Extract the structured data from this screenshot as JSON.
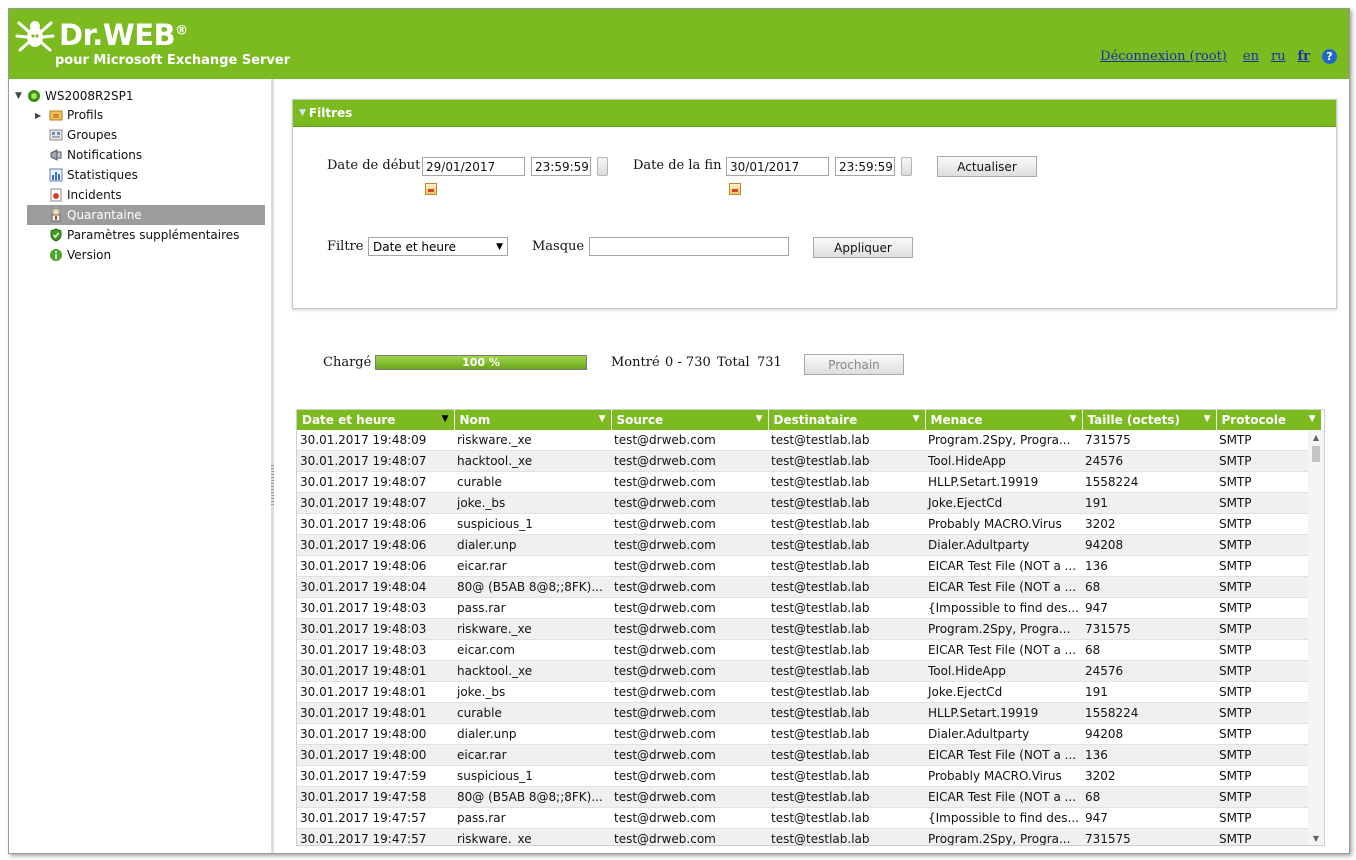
{
  "header": {
    "logo_text": "Dr.WEB",
    "logo_mark": "®",
    "subtitle": "pour Microsoft Exchange Server",
    "logout": "Déconnexion (root)",
    "lang_en": "en",
    "lang_ru": "ru",
    "lang_fr": "fr",
    "help": "?"
  },
  "sidebar": {
    "root": "WS2008R2SP1",
    "items": [
      {
        "label": "Profils",
        "icon": "folder-icon"
      },
      {
        "label": "Groupes",
        "icon": "groups-icon"
      },
      {
        "label": "Notifications",
        "icon": "megaphone-icon"
      },
      {
        "label": "Statistiques",
        "icon": "statistics-icon"
      },
      {
        "label": "Incidents",
        "icon": "incidents-icon"
      },
      {
        "label": "Quarantaine",
        "icon": "quarantine-icon"
      },
      {
        "label": "Paramètres supplémentaires",
        "icon": "shield-icon"
      },
      {
        "label": "Version",
        "icon": "info-icon"
      }
    ],
    "selected": "Quarantaine"
  },
  "filters": {
    "title": "Filtres",
    "start_label": "Date de début",
    "start_date": "29/01/2017",
    "start_time": "23:59:59",
    "end_label": "Date de la fin",
    "end_date": "30/01/2017",
    "end_time": "23:59:59",
    "refresh_button": "Actualiser",
    "filter_label": "Filtre",
    "filter_value": "Date et heure",
    "mask_label": "Masque",
    "mask_value": "",
    "apply_button": "Appliquer"
  },
  "status": {
    "loaded_label": "Chargé",
    "progress_text": "100 %",
    "progress_fraction": 1.0,
    "shown_label": "Montré",
    "shown_range": "0 - 730",
    "total_label": "Total",
    "total_value": "731",
    "next_button": "Prochain"
  },
  "table": {
    "columns": [
      "Date et heure",
      "Nom",
      "Source",
      "Destinataire",
      "Menace",
      "Taille (octets)",
      "Protocole"
    ],
    "rows": [
      [
        "30.01.2017 19:48:09",
        "riskware._xe",
        "test@drweb.com",
        "test@testlab.lab",
        "Program.2Spy, Progra...",
        "731575",
        "SMTP"
      ],
      [
        "30.01.2017 19:48:07",
        "hacktool._xe",
        "test@drweb.com",
        "test@testlab.lab",
        "Tool.HideApp",
        "24576",
        "SMTP"
      ],
      [
        "30.01.2017 19:48:07",
        "curable",
        "test@drweb.com",
        "test@testlab.lab",
        "HLLP.Setart.19919",
        "1558224",
        "SMTP"
      ],
      [
        "30.01.2017 19:48:07",
        "joke._bs",
        "test@drweb.com",
        "test@testlab.lab",
        "Joke.EjectCd",
        "191",
        "SMTP"
      ],
      [
        "30.01.2017 19:48:06",
        "suspicious_1",
        "test@drweb.com",
        "test@testlab.lab",
        "Probably MACRO.Virus",
        "3202",
        "SMTP"
      ],
      [
        "30.01.2017 19:48:06",
        "dialer.unp",
        "test@drweb.com",
        "test@testlab.lab",
        "Dialer.Adultparty",
        "94208",
        "SMTP"
      ],
      [
        "30.01.2017 19:48:06",
        "eicar.rar",
        "test@drweb.com",
        "test@testlab.lab",
        "EICAR Test File (NOT a ...",
        "136",
        "SMTP"
      ],
      [
        "30.01.2017 19:48:04",
        "80@ (B5AB 8@8;;8FK)...",
        "test@drweb.com",
        "test@testlab.lab",
        "EICAR Test File (NOT a ...",
        "68",
        "SMTP"
      ],
      [
        "30.01.2017 19:48:03",
        "pass.rar",
        "test@drweb.com",
        "test@testlab.lab",
        "{Impossible to find des...",
        "947",
        "SMTP"
      ],
      [
        "30.01.2017 19:48:03",
        "riskware._xe",
        "test@drweb.com",
        "test@testlab.lab",
        "Program.2Spy, Progra...",
        "731575",
        "SMTP"
      ],
      [
        "30.01.2017 19:48:03",
        "eicar.com",
        "test@drweb.com",
        "test@testlab.lab",
        "EICAR Test File (NOT a ...",
        "68",
        "SMTP"
      ],
      [
        "30.01.2017 19:48:01",
        "hacktool._xe",
        "test@drweb.com",
        "test@testlab.lab",
        "Tool.HideApp",
        "24576",
        "SMTP"
      ],
      [
        "30.01.2017 19:48:01",
        "joke._bs",
        "test@drweb.com",
        "test@testlab.lab",
        "Joke.EjectCd",
        "191",
        "SMTP"
      ],
      [
        "30.01.2017 19:48:01",
        "curable",
        "test@drweb.com",
        "test@testlab.lab",
        "HLLP.Setart.19919",
        "1558224",
        "SMTP"
      ],
      [
        "30.01.2017 19:48:00",
        "dialer.unp",
        "test@drweb.com",
        "test@testlab.lab",
        "Dialer.Adultparty",
        "94208",
        "SMTP"
      ],
      [
        "30.01.2017 19:48:00",
        "eicar.rar",
        "test@drweb.com",
        "test@testlab.lab",
        "EICAR Test File (NOT a ...",
        "136",
        "SMTP"
      ],
      [
        "30.01.2017 19:47:59",
        "suspicious_1",
        "test@drweb.com",
        "test@testlab.lab",
        "Probably MACRO.Virus",
        "3202",
        "SMTP"
      ],
      [
        "30.01.2017 19:47:58",
        "80@ (B5AB 8@8;;8FK)...",
        "test@drweb.com",
        "test@testlab.lab",
        "EICAR Test File (NOT a ...",
        "68",
        "SMTP"
      ],
      [
        "30.01.2017 19:47:57",
        "pass.rar",
        "test@drweb.com",
        "test@testlab.lab",
        "{Impossible to find des...",
        "947",
        "SMTP"
      ],
      [
        "30.01.2017 19:47:57",
        "riskware._xe",
        "test@drweb.com",
        "test@testlab.lab",
        "Program.2Spy, Progra...",
        "731575",
        "SMTP"
      ]
    ]
  },
  "colors": {
    "brand_green": "#7cbb1f",
    "selection_gray": "#9c9c9c",
    "link_blue": "#1a2fa8"
  }
}
